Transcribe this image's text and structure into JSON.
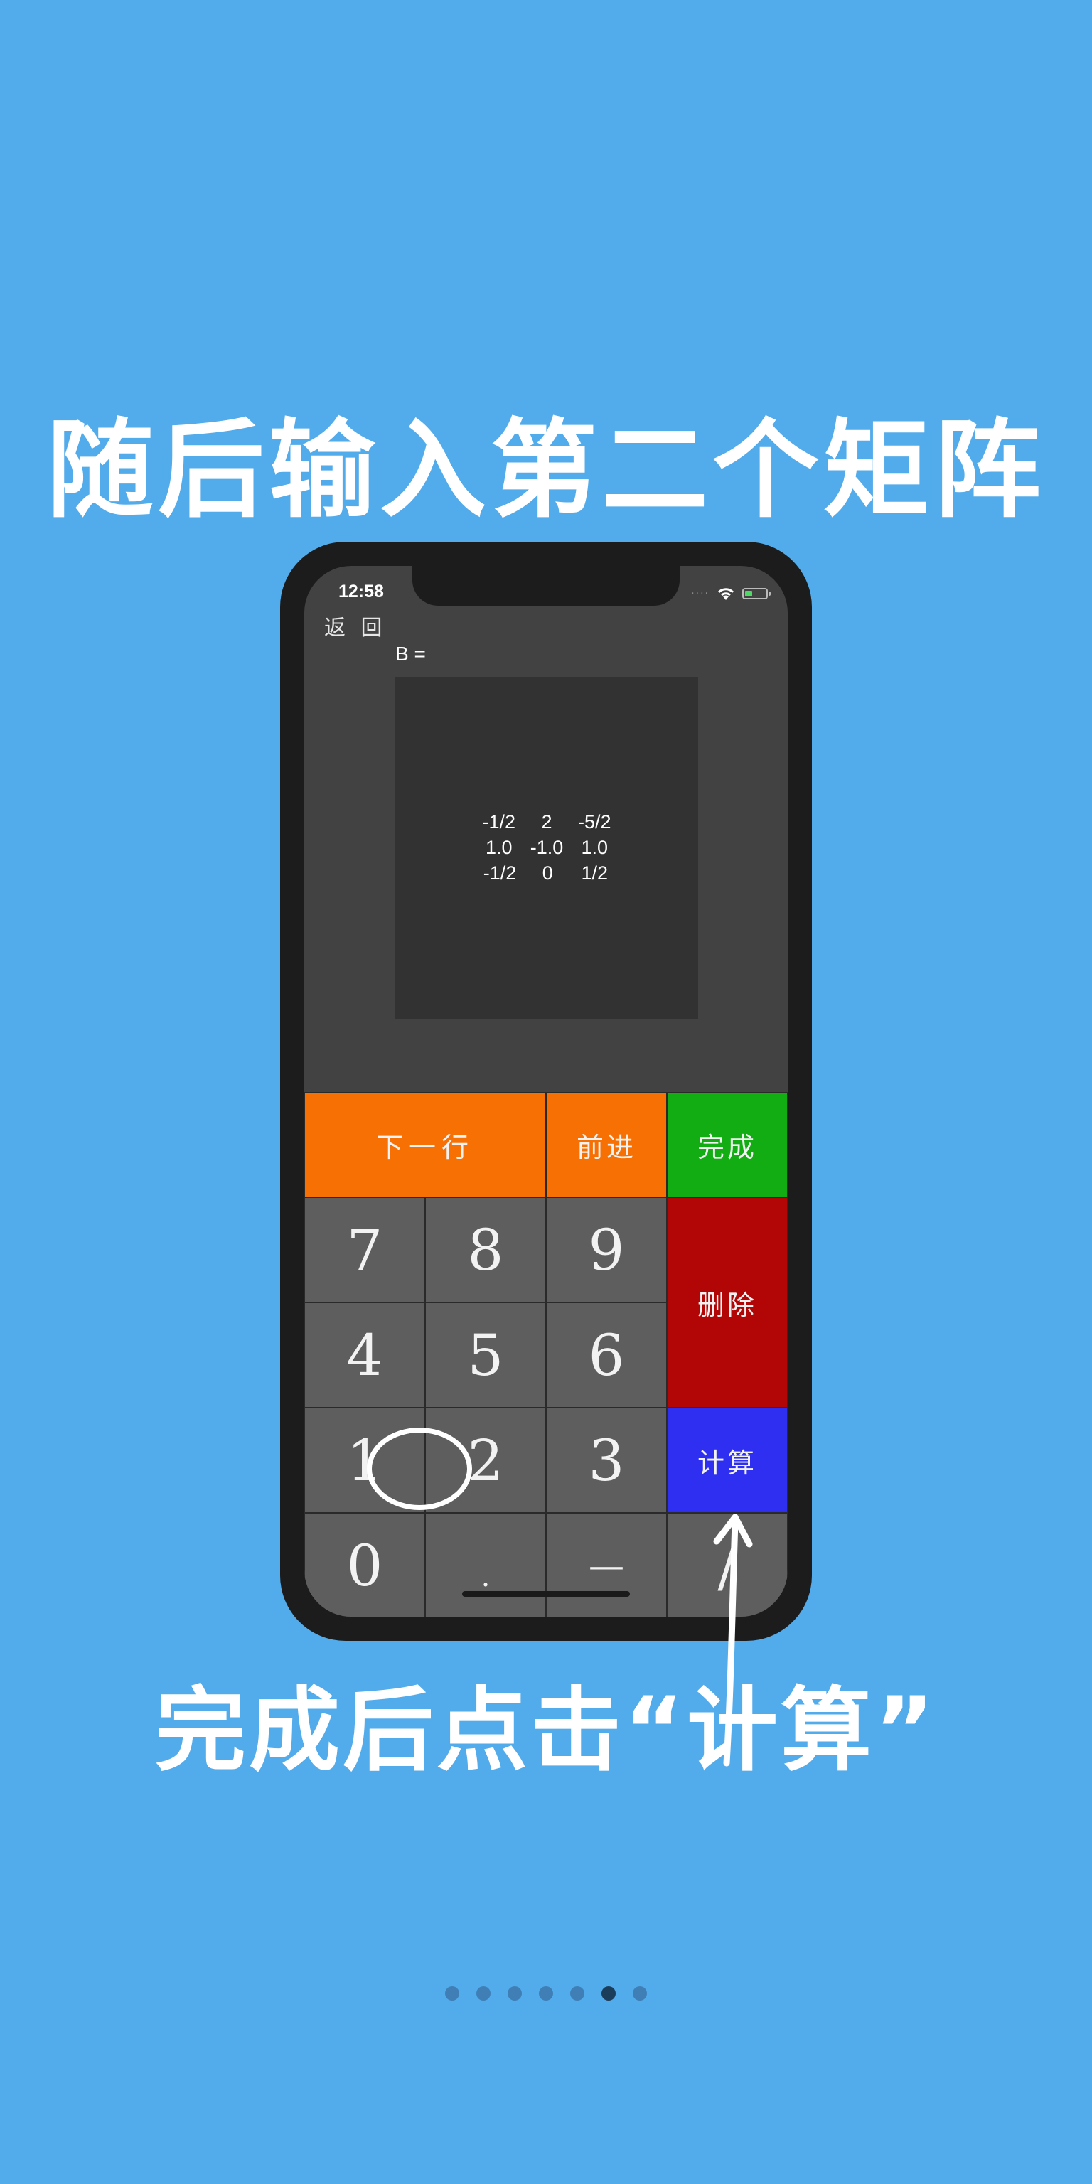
{
  "headline": "随后输入第二个矩阵",
  "caption": "完成后点击“计算”",
  "status": {
    "time": "12:58"
  },
  "nav": {
    "back_label": "返 回"
  },
  "matrix": {
    "label": "B =",
    "rows": [
      [
        "-1/2",
        "2",
        "-5/2"
      ],
      [
        "1.0",
        "-1.0",
        "1.0"
      ],
      [
        "-1/2",
        "0",
        "1/2"
      ]
    ]
  },
  "keypad": {
    "next_row": "下一行",
    "forward": "前进",
    "done": "完成",
    "delete": "删除",
    "calculate": "计算",
    "digits": [
      "7",
      "8",
      "9",
      "4",
      "5",
      "6",
      "1",
      "2",
      "3",
      "0",
      ".",
      "—",
      "/"
    ]
  },
  "colors": {
    "background": "#52abea",
    "orange": "#f77003",
    "green": "#12ad12",
    "red": "#b20606",
    "blue": "#2e2ff0",
    "key_gray": "#5e5e5e"
  },
  "pager": {
    "count": 7,
    "active_index": 5
  }
}
